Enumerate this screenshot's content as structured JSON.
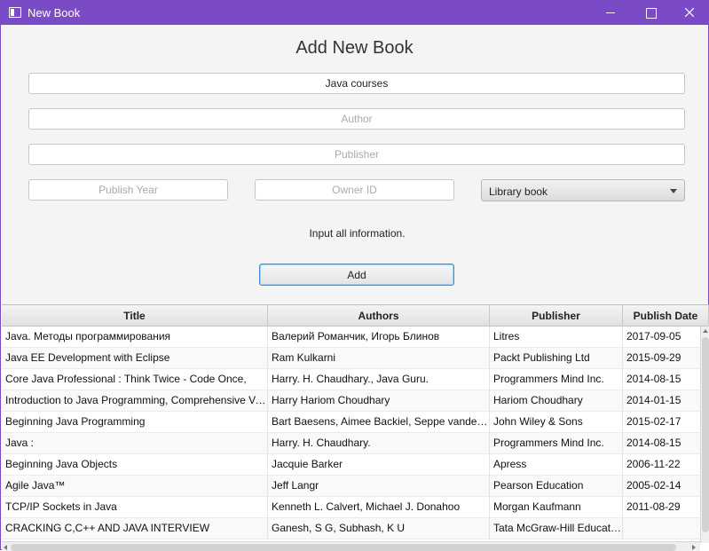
{
  "window": {
    "title": "New Book",
    "accent_color": "#7b4bc7",
    "icons": {
      "app": "window-icon",
      "minimize": "minimize-icon",
      "maximize": "maximize-icon",
      "close": "close-icon"
    }
  },
  "form": {
    "heading": "Add New Book",
    "title_value": "Java courses",
    "author_placeholder": "Author",
    "publisher_placeholder": "Publisher",
    "year_placeholder": "Publish Year",
    "owner_placeholder": "Owner ID",
    "type_select": "Library book",
    "status": "Input all information.",
    "add_label": "Add"
  },
  "table": {
    "columns": [
      "Title",
      "Authors",
      "Publisher",
      "Publish Date"
    ],
    "rows": [
      [
        "Java. Методы программирования",
        "Валерий Романчик, Игорь Блинов",
        "Litres",
        "2017-09-05"
      ],
      [
        "Java EE Development with Eclipse",
        "Ram Kulkarni",
        "Packt Publishing Ltd",
        "2015-09-29"
      ],
      [
        "Core Java Professional : Think Twice - Code Once,",
        "Harry. H. Chaudhary., Java Guru.",
        "Programmers Mind Inc.",
        "2014-08-15"
      ],
      [
        "Introduction to Java Programming, Comprehensive Version",
        "Harry Hariom Choudhary",
        "Hariom Choudhary",
        "2014-01-15"
      ],
      [
        "Beginning Java Programming",
        "Bart Baesens, Aimee Backiel, Seppe vanden Broucke",
        "John Wiley & Sons",
        "2015-02-17"
      ],
      [
        "Java :",
        "Harry. H. Chaudhary.",
        "Programmers Mind Inc.",
        "2014-08-15"
      ],
      [
        "Beginning Java Objects",
        "Jacquie Barker",
        "Apress",
        "2006-11-22"
      ],
      [
        "Agile Java™",
        "Jeff Langr",
        "Pearson Education",
        "2005-02-14"
      ],
      [
        "TCP/IP Sockets in Java",
        "Kenneth L. Calvert, Michael J. Donahoo",
        "Morgan Kaufmann",
        "2011-08-29"
      ],
      [
        "CRACKING C,C++ AND JAVA INTERVIEW",
        "Ganesh, S G, Subhash, K U",
        "Tata McGraw-Hill Education",
        ""
      ]
    ]
  }
}
